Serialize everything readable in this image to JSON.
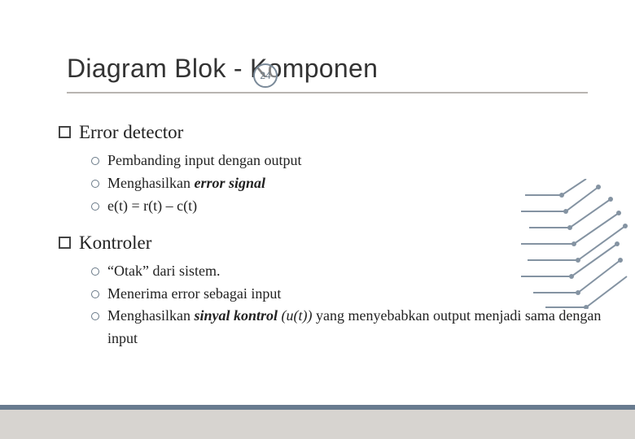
{
  "title": "Diagram Blok - Komponen",
  "page_number": "24",
  "sections": [
    {
      "heading": "Error detector",
      "items": [
        {
          "html": "Pembanding input dengan output"
        },
        {
          "html": "Menghasilkan <span class=\"bi\">error signal</span>"
        },
        {
          "html": "e(t) = r(t) – c(t)"
        }
      ]
    },
    {
      "heading": "Kontroler",
      "items": [
        {
          "html": "“Otak” dari sistem."
        },
        {
          "html": "Menerima error sebagai input"
        },
        {
          "html": "Menghasilkan <span class=\"bi\">sinyal kontrol</span> <i>(u(t))</i> yang menyebabkan output menjadi sama dengan input"
        }
      ]
    }
  ],
  "colors": {
    "accent": "#687b8f",
    "footer": "#d7d4d0"
  }
}
